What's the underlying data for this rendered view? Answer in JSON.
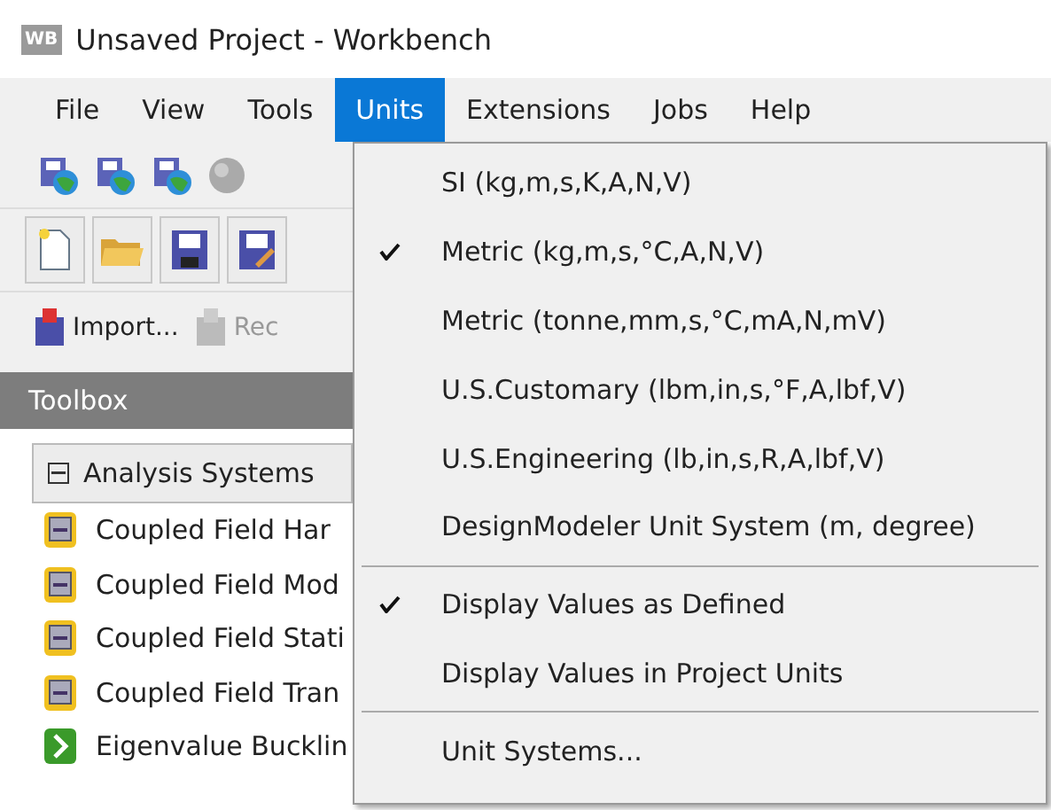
{
  "window": {
    "title": "Unsaved Project - Workbench",
    "app_icon": "WB"
  },
  "menu_bar": [
    {
      "label": "File",
      "selected": false
    },
    {
      "label": "View",
      "selected": false
    },
    {
      "label": "Tools",
      "selected": false
    },
    {
      "label": "Units",
      "selected": true
    },
    {
      "label": "Extensions",
      "selected": false
    },
    {
      "label": "Jobs",
      "selected": false
    },
    {
      "label": "Help",
      "selected": false
    }
  ],
  "toolbar_3": [
    {
      "label": "Import...",
      "disabled": false
    },
    {
      "label": "Rec",
      "disabled": true
    }
  ],
  "toolbox": {
    "title": "Toolbox",
    "group": {
      "label": "Analysis Systems",
      "expanded": true,
      "items": [
        {
          "label": "Coupled Field Har",
          "kind": "coupled"
        },
        {
          "label": "Coupled Field Mod",
          "kind": "coupled"
        },
        {
          "label": "Coupled Field Stati",
          "kind": "coupled"
        },
        {
          "label": "Coupled Field Tran",
          "kind": "coupled"
        },
        {
          "label": "Eigenvalue Bucklin",
          "kind": "buckling"
        }
      ]
    }
  },
  "units_menu": [
    {
      "kind": "item",
      "label": "SI (kg,m,s,K,A,N,V)",
      "checked": false
    },
    {
      "kind": "item",
      "label": "Metric (kg,m,s,°C,A,N,V)",
      "checked": true
    },
    {
      "kind": "item",
      "label": "Metric (tonne,mm,s,°C,mA,N,mV)",
      "checked": false
    },
    {
      "kind": "item",
      "label": "U.S.Customary (lbm,in,s,°F,A,lbf,V)",
      "checked": false
    },
    {
      "kind": "item",
      "label": "U.S.Engineering (lb,in,s,R,A,lbf,V)",
      "checked": false
    },
    {
      "kind": "item",
      "label": "DesignModeler Unit System (m, degree)",
      "checked": false
    },
    {
      "kind": "separator"
    },
    {
      "kind": "item",
      "label": "Display Values as Defined",
      "checked": true
    },
    {
      "kind": "item",
      "label": "Display Values in Project Units",
      "checked": false
    },
    {
      "kind": "separator"
    },
    {
      "kind": "item",
      "label": "Unit Systems...",
      "checked": false
    }
  ]
}
